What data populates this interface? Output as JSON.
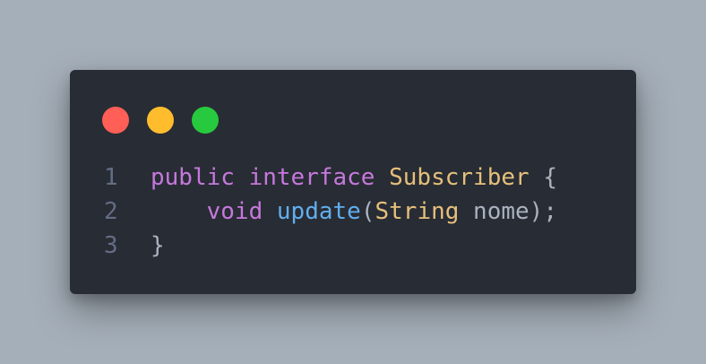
{
  "window": {
    "controls": {
      "close_color": "#ff5f56",
      "minimize_color": "#ffbd2e",
      "zoom_color": "#27c93f"
    }
  },
  "colors": {
    "background": "#a5afb9",
    "editor_bg": "#282c34",
    "line_number": "#636d83",
    "keyword": "#c678dd",
    "type": "#e5c07b",
    "function": "#61afef",
    "plain": "#abb2bf"
  },
  "code": {
    "lines": [
      {
        "number": "1",
        "tokens": [
          {
            "text": "public",
            "kind": "keyword"
          },
          {
            "text": " ",
            "kind": "plain"
          },
          {
            "text": "interface",
            "kind": "keyword"
          },
          {
            "text": " ",
            "kind": "plain"
          },
          {
            "text": "Subscriber",
            "kind": "type"
          },
          {
            "text": " {",
            "kind": "plain"
          }
        ]
      },
      {
        "number": "2",
        "tokens": [
          {
            "text": "    ",
            "kind": "plain"
          },
          {
            "text": "void",
            "kind": "keyword"
          },
          {
            "text": " ",
            "kind": "plain"
          },
          {
            "text": "update",
            "kind": "function"
          },
          {
            "text": "(",
            "kind": "plain"
          },
          {
            "text": "String",
            "kind": "type"
          },
          {
            "text": " nome);",
            "kind": "plain"
          }
        ]
      },
      {
        "number": "3",
        "tokens": [
          {
            "text": "}",
            "kind": "plain"
          }
        ]
      }
    ]
  }
}
